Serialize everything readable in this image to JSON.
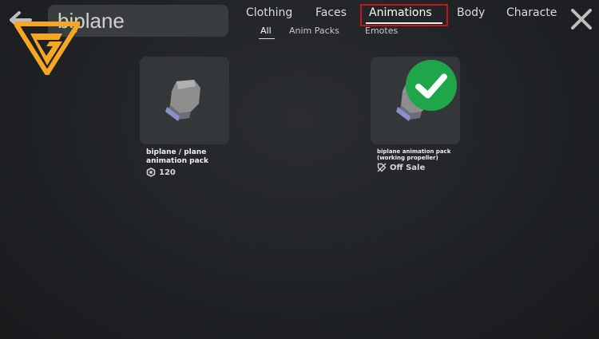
{
  "search": {
    "query": "biplane"
  },
  "tabs": [
    {
      "label": "Clothing"
    },
    {
      "label": "Faces"
    },
    {
      "label": "Animations"
    },
    {
      "label": "Body"
    },
    {
      "label": "Characte"
    }
  ],
  "active_tab": "Animations",
  "subtabs": [
    {
      "label": "All"
    },
    {
      "label": "Anim Packs"
    },
    {
      "label": "Emotes"
    }
  ],
  "active_subtab": "All",
  "items": [
    {
      "title_line1": "biplane / plane",
      "title_line2": "animation pack",
      "price": "120",
      "owned": false
    },
    {
      "title_line1": "biplane animation pack",
      "title_line2": "(working propeller)",
      "price": "Off Sale",
      "owned": true
    }
  ],
  "colors": {
    "highlight": "#c8141c",
    "logo": "#f5a623",
    "check": "#1fa64a"
  }
}
